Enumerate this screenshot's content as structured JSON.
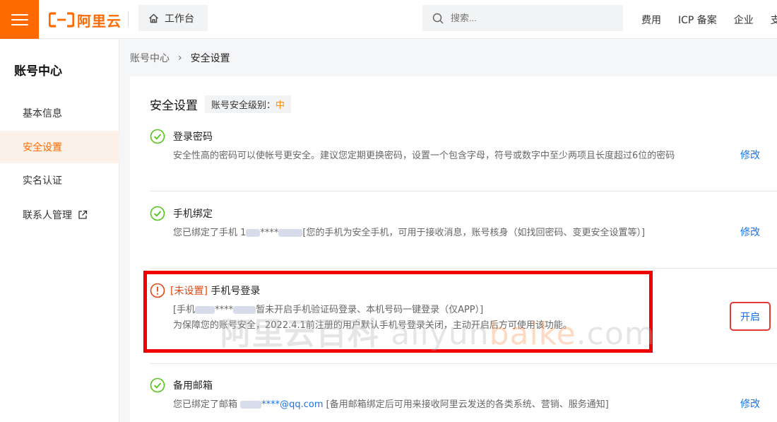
{
  "topbar": {
    "logo_text": "阿里云",
    "workbench_label": "工作台",
    "search_placeholder": "搜索...",
    "links": [
      "费用",
      "ICP 备案",
      "企业",
      "支"
    ]
  },
  "sidebar": {
    "title": "账号中心",
    "items": [
      {
        "label": "基本信息"
      },
      {
        "label": "安全设置"
      },
      {
        "label": "实名认证"
      },
      {
        "label": "联系人管理"
      }
    ]
  },
  "breadcrumb": {
    "parent": "账号中心",
    "separator": "›",
    "current": "安全设置"
  },
  "card": {
    "title": "安全设置",
    "level_label": "账号安全级别：",
    "level_value": "中",
    "rows": [
      {
        "status": "ok",
        "title": "登录密码",
        "desc": "安全性高的密码可以使帐号更安全。建议您定期更换密码，设置一个包含字母，符号或数字中至少两项且长度超过6位的密码",
        "action": "修改"
      },
      {
        "status": "ok",
        "title": "手机绑定",
        "desc_prefix": "您已绑定了手机 1",
        "desc_mask": "****",
        "desc_suffix": "[您的手机为安全手机，可用于接收消息，账号核身（如找回密码、变更安全设置等）]",
        "action": "修改"
      },
      {
        "status": "warn",
        "tag": "[未设置]",
        "title": "手机号登录",
        "desc1_prefix": "[手机",
        "desc1_mask": "****",
        "desc1_suffix": "暂未开启手机验证码登录、本机号码一键登录（仅APP）]",
        "desc2": "为保障您的账号安全，2022.4.1前注册的用户默认手机号登录关闭，主动开启后方可使用该功能。",
        "action": "开启"
      },
      {
        "status": "ok",
        "title": "备用邮箱",
        "desc_prefix": "您已绑定了邮箱 ",
        "desc_email": "****@qq.com",
        "desc_suffix": " [备用邮箱绑定后可用来接收阿里云发送的各类系统、营销、服务通知]",
        "action": "修改"
      }
    ]
  },
  "watermark": {
    "cn": "阿里云百科",
    "en1": "aliyun",
    "en2": "baike",
    "en3": ".com"
  },
  "colors": {
    "brand": "#ff6a00",
    "link": "#1a73e8",
    "ok": "#52c41a",
    "warn": "#e6450f",
    "highlight": "#e00000"
  }
}
